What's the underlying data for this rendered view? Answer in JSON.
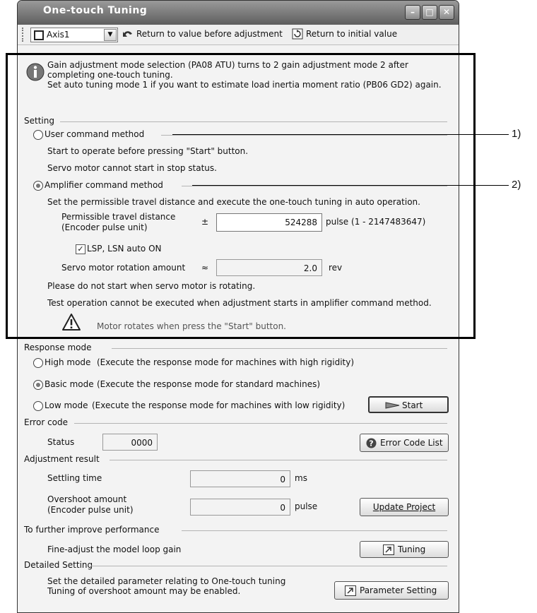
{
  "window": {
    "title": "One-touch Tuning"
  },
  "toolbar": {
    "axis_value": "Axis1",
    "return_adjust_label": "Return to value before adjustment",
    "return_initial_label": "Return to initial value"
  },
  "info": {
    "line1": "Gain adjustment mode selection (PA08 ATU) turns to 2 gain adjustment mode 2 after",
    "line2": "completing one-touch tuning.",
    "line3": "Set auto tuning mode 1 if you want to estimate load inertia moment ratio (PB06 GD2) again."
  },
  "setting": {
    "label": "Setting",
    "user_method_label": "User command method",
    "user_desc1": "Start to operate before pressing \"Start\" button.",
    "user_desc2": "Servo motor cannot start in stop status.",
    "amp_method_label": "Amplifier command method",
    "amp_desc": "Set the permissible travel distance and execute the one-touch tuning in auto operation.",
    "travel_label1": "Permissible travel distance",
    "travel_label2": "(Encoder pulse unit)",
    "plusminus": "±",
    "travel_value": "524288",
    "travel_unit": "pulse (1 - 2147483647)",
    "lsp_label": "LSP, LSN auto ON",
    "rotation_label": "Servo motor rotation amount",
    "approx": "≈",
    "rotation_value": "2.0",
    "rotation_unit": "rev",
    "note1": "Please do not start when servo motor is rotating.",
    "note2": "Test operation cannot be executed when adjustment starts in amplifier command method.",
    "warning_text": "Motor rotates when press the \"Start\" button."
  },
  "response": {
    "label": "Response mode",
    "high_label": "High mode",
    "high_desc": "(Execute the response mode for machines with high rigidity)",
    "basic_label": "Basic mode",
    "basic_desc": "(Execute the response mode for standard machines)",
    "low_label": "Low mode",
    "low_desc": "(Execute the response mode for machines with low rigidity)",
    "start_label": "Start"
  },
  "error_code": {
    "label": "Error code",
    "status_label": "Status",
    "status_value": "0000",
    "list_button": "Error Code List"
  },
  "adjustment": {
    "label": "Adjustment result",
    "settling_label": "Settling time",
    "settling_value": "0",
    "settling_unit": "ms",
    "overshoot_label1": "Overshoot amount",
    "overshoot_label2": "(Encoder pulse unit)",
    "overshoot_value": "0",
    "overshoot_unit": "pulse",
    "update_button": "Update Project"
  },
  "improve": {
    "label": "To further improve performance",
    "fine_label": "Fine-adjust the model loop gain",
    "tuning_button": "Tuning"
  },
  "detailed": {
    "label": "Detailed Setting",
    "line1": "Set the detailed parameter relating to One-touch tuning",
    "line2": "Tuning of overshoot amount may be enabled.",
    "param_button": "Parameter Setting"
  },
  "callouts": {
    "one": "1)",
    "two": "2)"
  }
}
